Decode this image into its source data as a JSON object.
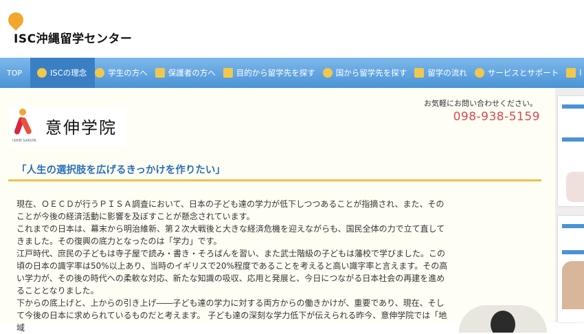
{
  "header": {
    "logo_text": "ISC沖縄留学センター"
  },
  "nav": {
    "top": "TOP",
    "items": [
      {
        "label": "ISCの理念",
        "icon": "exclamation-icon"
      },
      {
        "label": "学生の方へ",
        "icon": "student-icon"
      },
      {
        "label": "保護者の方へ",
        "icon": "parents-icon"
      },
      {
        "label": "目的から留学先を探す",
        "icon": "flag-icon"
      },
      {
        "label": "国から留学先を探す",
        "icon": "globe-icon"
      },
      {
        "label": "留学の流れ",
        "icon": "flow-arrows-icon"
      },
      {
        "label": "サービスとサポート",
        "icon": "speech-bubble-icon"
      },
      {
        "label": "l",
        "icon": "book-icon"
      }
    ]
  },
  "school": {
    "name": "意伸学院",
    "romaji": "ISHIN GAKUIN"
  },
  "contact": {
    "text": "お気軽にお問い合わせください。",
    "phone": "098-938-5159"
  },
  "catch_copy": "「人生の選択肢を広げるきっかけを作りたい」",
  "body": {
    "p1": "現在、ＯＥＣＤが行うＰＩＳＡ調査において、日本の子ども達の学力が低下しつつあることが指摘され、また、そのことが今後の経済活動に影響を及ぼすことが懸念されています。",
    "p2": "これまでの日本は、幕末から明治維新、第２次大戦後と大きな経済危機を迎えながらも、国民全体の力で立て直してきました。その復興の底力となったのは「学力」です。",
    "p3": "江戸時代、庶民の子どもは寺子屋で読み・書き・そろばんを習い、また武士階級の子どもは藩校で学びました。この頃の日本の識字率は50%以上あり、当時のイギリスで20%程度であることを考えると高い識字率と言えます。その高い学力が、その後の時代への柔軟な対応、新たな知識の吸収、応用と発展と、今日につながる日本社会の再建を進めることとなりました。",
    "p4": "下からの底上げと、上からの引き上げ――子ども達の学力に対する両方からの働きかけが、重要であり、現在、そして今後の日本に求められているものだと考えます。 子ども達の深刻な学力低下が伝えられる昨今、意伸学院では「地域"
  }
}
